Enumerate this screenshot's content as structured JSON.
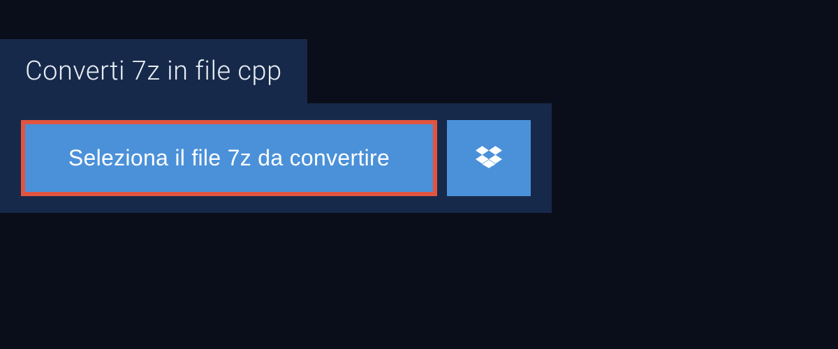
{
  "header": {
    "title": "Converti 7z in file cpp"
  },
  "converter": {
    "select_file_label": "Seleziona il file 7z da convertire"
  }
}
